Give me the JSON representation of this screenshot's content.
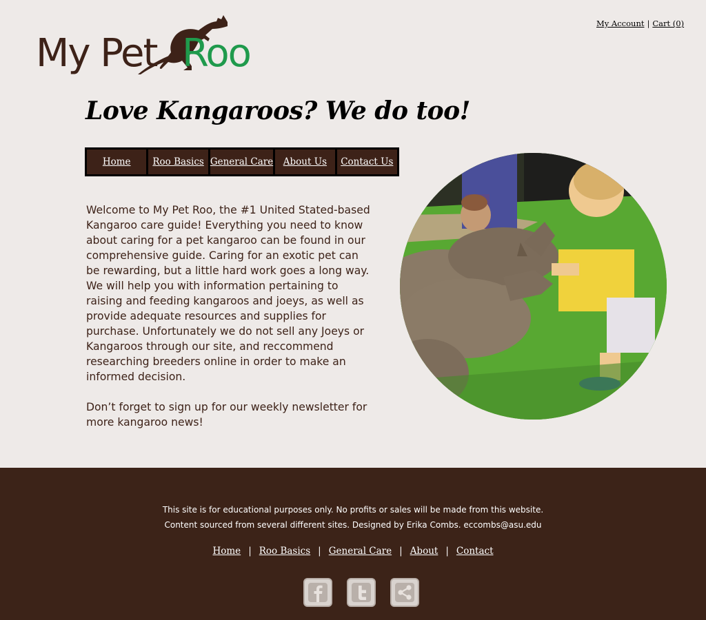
{
  "header": {
    "my_account": "My Account",
    "separator": "|",
    "cart": "Cart (0)"
  },
  "logo": {
    "word1": "My Pet",
    "word2": "Roo",
    "colors": {
      "brown": "#3d2218",
      "green": "#1f9a4c"
    }
  },
  "tagline": "Love Kangaroos? We do too!",
  "nav": {
    "items": [
      {
        "label": "Home"
      },
      {
        "label": "Roo Basics"
      },
      {
        "label": "General Care"
      },
      {
        "label": "About Us"
      },
      {
        "label": "Contact Us"
      }
    ]
  },
  "intro": {
    "paragraph1": "Welcome to My Pet Roo, the #1 United Stated-based Kangaroo care guide! Everything you need to know about caring for a pet kangaroo can be found in our comprehensive guide. Caring for an exotic pet can be rewarding, but a little hard work goes a long way. We will help you with information pertaining to raising and feeding kangaroos and joeys, as well as provide adequate resources and supplies for purchase. Unfortunately we do not sell any Joeys or Kangaroos through our site, and reccommend researching breeders online in order to make an informed decision.",
    "paragraph2": "Don’t forget to sign up for our weekly newsletter for more kangaroo news!"
  },
  "footer": {
    "disclaimer_line1": "This site is for educational purposes only. No profits or sales will be made from this website.",
    "disclaimer_line2": "Content sourced from several different sites. Designed by Erika Combs. eccombs@asu.edu",
    "nav": [
      {
        "label": "Home"
      },
      {
        "label": "Roo Basics"
      },
      {
        "label": "General Care"
      },
      {
        "label": "About"
      },
      {
        "label": "Contact"
      }
    ],
    "nav_separator": "|",
    "social": [
      {
        "icon": "facebook-icon"
      },
      {
        "icon": "twitter-icon"
      },
      {
        "icon": "share-icon"
      }
    ],
    "background": "#3c2318"
  }
}
